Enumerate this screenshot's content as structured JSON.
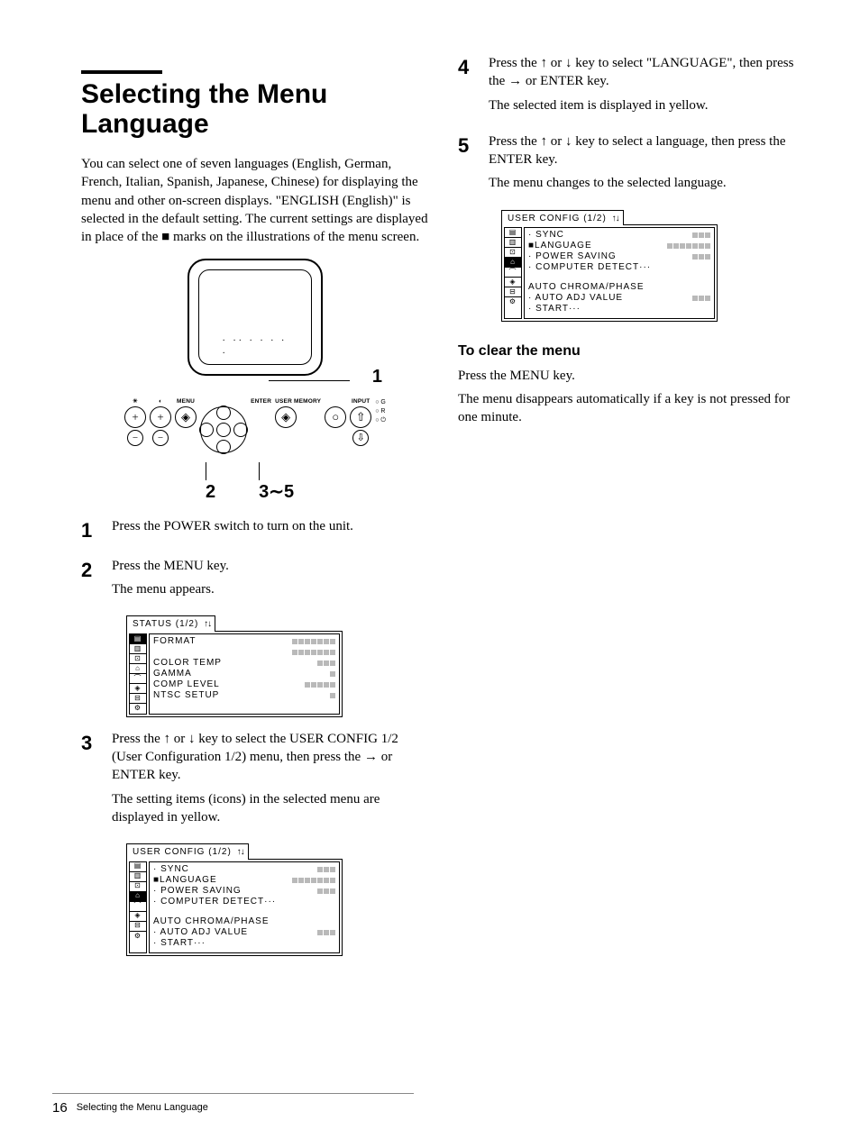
{
  "title": "Selecting the Menu Language",
  "intro": "You can select one of seven languages (English, German, French, Italian, Spanish, Japanese, Chinese) for displaying the menu and other on-screen displays. \"ENGLISH (English)\" is selected in the default setting. The current settings are displayed in place of the ■ marks on the illustrations of the menu screen.",
  "panel": {
    "callout1": "1",
    "menu_label": "MENU",
    "enter_label": "ENTER",
    "user_mem_label": "USER MEMORY",
    "input_label": "INPUT",
    "led_g": "G",
    "led_r": "R",
    "callout2": "2",
    "callout35": "3∼5"
  },
  "steps": {
    "s1": {
      "num": "1",
      "text": "Press the POWER switch to turn on the unit."
    },
    "s2": {
      "num": "2",
      "l1": "Press the MENU key.",
      "l2": "The menu appears."
    },
    "s3": {
      "num": "3",
      "l1a": "Press the ",
      "l1b": " or ",
      "l1c": " key to select the USER CONFIG 1/2 (User Configuration 1/2) menu, then press the ",
      "l1d": " or ENTER key.",
      "l2": "The setting items (icons) in the selected menu are displayed in yellow."
    },
    "s4": {
      "num": "4",
      "l1a": "Press the ",
      "l1b": " or ",
      "l1c": " key to select \"LANGUAGE\", then press the ",
      "l1d": " or ENTER key.",
      "l2": "The selected item is displayed in yellow."
    },
    "s5": {
      "num": "5",
      "l1a": "Press the ",
      "l1b": " or ",
      "l1c": " key to select a language, then press the ENTER key.",
      "l2": "The menu changes to the selected language."
    }
  },
  "osd_status": {
    "title": "STATUS  (1/2)",
    "rows": [
      {
        "label": "FORMAT",
        "pre": "",
        "boxes": 7,
        "sel": true
      },
      {
        "label": "",
        "pre": "",
        "boxes": 7
      },
      {
        "label": "COLOR TEMP",
        "pre": "",
        "boxes": 3
      },
      {
        "label": "GAMMA",
        "pre": "",
        "boxes": 1
      },
      {
        "label": "COMP LEVEL",
        "pre": "",
        "boxes": 5
      },
      {
        "label": "NTSC SETUP",
        "pre": "",
        "boxes": 1
      }
    ]
  },
  "osd_user": {
    "title": "USER CONFIG  (1/2)",
    "rows": [
      {
        "label": "SYNC",
        "pre": "· ",
        "boxes": 3
      },
      {
        "label": "LANGUAGE",
        "pre": "■",
        "boxes": 7,
        "sel": true
      },
      {
        "label": "POWER SAVING",
        "pre": "· ",
        "boxes": 3
      },
      {
        "label": "COMPUTER DETECT···",
        "pre": "· ",
        "boxes": 0
      },
      {
        "label": "",
        "pre": "",
        "boxes": 0,
        "blank": true
      },
      {
        "label": "AUTO CHROMA/PHASE",
        "pre": "",
        "boxes": 0
      },
      {
        "label": "AUTO ADJ VALUE",
        "pre": "· ",
        "boxes": 3
      },
      {
        "label": "START···",
        "pre": "· ",
        "boxes": 0
      }
    ]
  },
  "clear": {
    "heading": "To clear the menu",
    "l1": "Press the MENU key.",
    "l2": "The menu disappears automatically if a key is not pressed for one minute."
  },
  "footer": {
    "page": "16",
    "title": "Selecting the Menu Language"
  }
}
